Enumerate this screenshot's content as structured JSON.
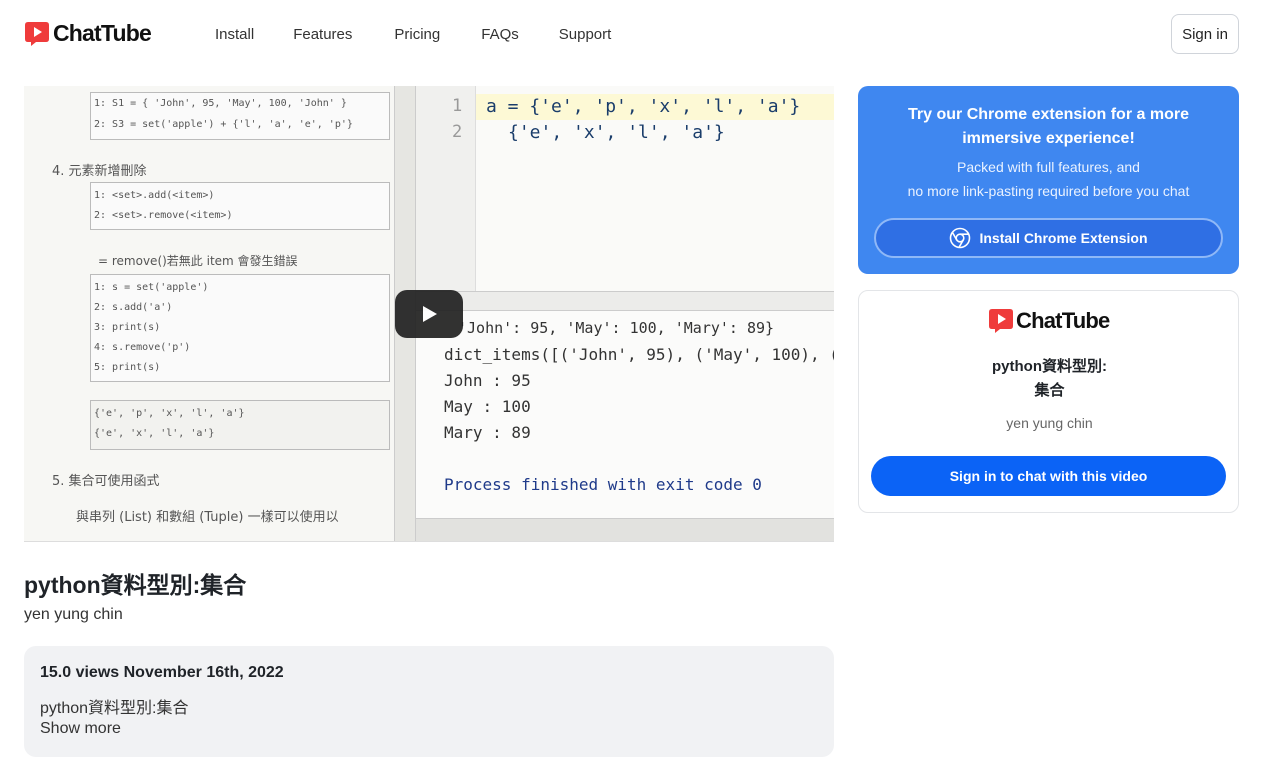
{
  "brand": {
    "name": "ChatTube",
    "color": "#ef3b3b"
  },
  "nav": {
    "items": [
      {
        "label": "Install"
      },
      {
        "label": "Features"
      },
      {
        "label": "Pricing"
      },
      {
        "label": "FAQs"
      },
      {
        "label": "Support"
      }
    ],
    "signin_label": "Sign in"
  },
  "video_frame": {
    "left_lines": {
      "l1": "1: S1 = { 'John', 95, 'May', 100, 'John' }",
      "l2": "2: S3 = set('apple')  + {'l', 'a', 'e', 'p'}",
      "h4": "4.  元素新增刪除",
      "a1": "1: <set>.add(<item>)",
      "a2": "2: <set>.remove(<item>)",
      "note": "= remove()若無此 item 會發生錯誤",
      "b1": "1: s = set('apple')",
      "b2": "2: s.add('a')",
      "b3": "3: print(s)",
      "b4": "4: s.remove('p')",
      "b5": "5: print(s)",
      "c1": "{'e', 'p', 'x', 'l', 'a'}",
      "c2": "{'e', 'x', 'l', 'a'}",
      "h5": "5.  集合可使用函式",
      "last": "與串列 (List) 和數組 (Tuple) 一樣可以使用以"
    },
    "editor_lines": {
      "n1": "1",
      "n2": "2",
      "code1": "a = {'e', 'p', 'x', 'l', 'a'}",
      "code2": "{'e', 'x', 'l', 'a'}"
    },
    "output_lines": {
      "o1": "'John': 95, 'May': 100, 'Mary': 89}",
      "o2": "dict_items([('John', 95), ('May', 100), (",
      "o3": "John : 95",
      "o4": "May : 100",
      "o5": "Mary : 89",
      "o6": "Process finished with exit code 0"
    }
  },
  "video": {
    "title": "python資料型別:集合",
    "author": "yen yung chin"
  },
  "description": {
    "meta": "15.0 views  November 16th, 2022",
    "text": "python資料型別:集合",
    "show_more": "Show more"
  },
  "promo": {
    "title": "Try our Chrome extension for a more immersive experience!",
    "subtitle_line1": "Packed with full features, and",
    "subtitle_line2": "no more link-pasting required before you chat",
    "button_label": "Install Chrome Extension",
    "bg_color": "#3f87f0"
  },
  "video_card": {
    "title_line1": "python資料型別:",
    "title_line2": "集合",
    "author": "yen yung chin",
    "button_label": "Sign in to chat with this video",
    "button_color": "#0b63f6"
  }
}
